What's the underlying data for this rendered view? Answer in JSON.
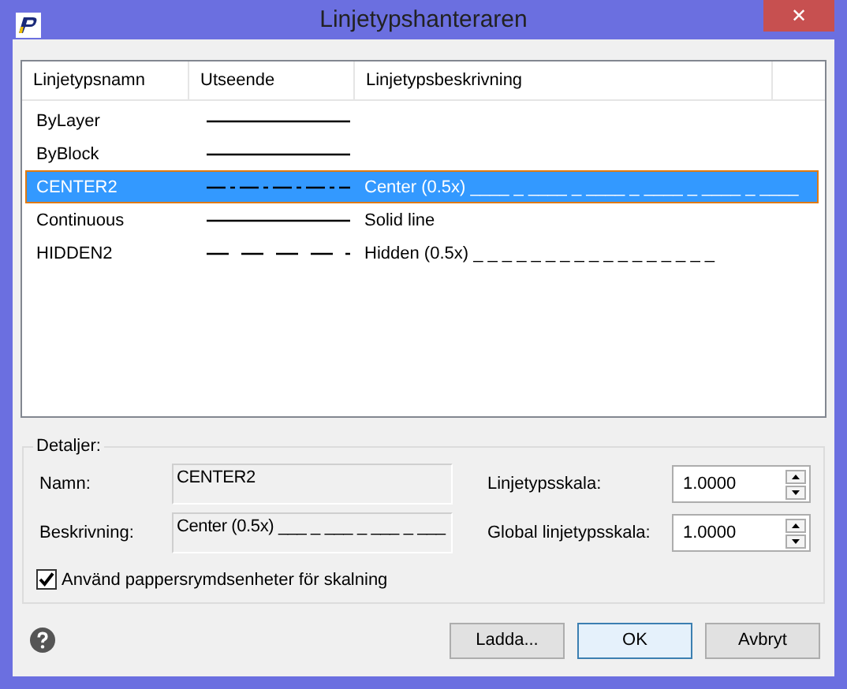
{
  "window": {
    "title": "Linjetypshanteraren",
    "close": "✕"
  },
  "table": {
    "columns": [
      "Linjetypsnamn",
      "Utseende",
      "Linjetypsbeskrivning"
    ],
    "rows": [
      {
        "name": "ByLayer",
        "kind": "solid",
        "description": "",
        "selected": false
      },
      {
        "name": "ByBlock",
        "kind": "solid",
        "description": "",
        "selected": false
      },
      {
        "name": "CENTER2",
        "kind": "center",
        "description": "Center (0.5x) ____ _ ____ _ ____ _ ____ _ ____ _ ____",
        "selected": true
      },
      {
        "name": "Continuous",
        "kind": "solid",
        "description": "Solid line",
        "selected": false
      },
      {
        "name": "HIDDEN2",
        "kind": "hidden",
        "description": "Hidden (0.5x) _ _ _ _ _ _ _ _ _ _ _ _ _ _ _ _ _",
        "selected": false
      }
    ]
  },
  "details": {
    "title": "Detaljer:",
    "name_label": "Namn:",
    "name_value": "CENTER2",
    "description_label": "Beskrivning:",
    "description_value": "Center (0.5x) ___ _ ___ _ ___ _ ___",
    "scale_label": "Linjetypsskala:",
    "scale_value": "1.0000",
    "global_scale_label": "Global linjetypsskala:",
    "global_scale_value": "1.0000",
    "paper_space": {
      "label": "Använd pappersrymdsenheter för skalning",
      "checked": true
    }
  },
  "buttons": [
    "Ladda...",
    "OK",
    "Avbryt"
  ]
}
